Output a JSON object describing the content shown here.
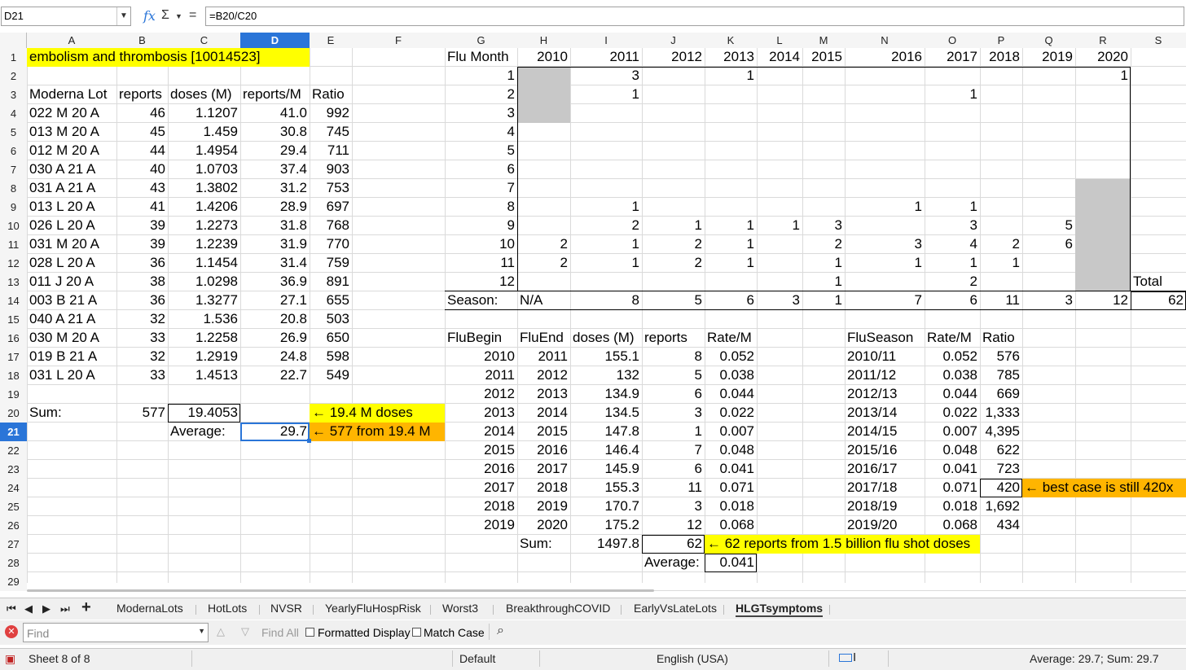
{
  "formula_bar": {
    "name_box": "D21",
    "formula": "=B20/C20",
    "icons": [
      "function-wizard-icon",
      "sum-icon",
      "equals-icon"
    ]
  },
  "columns": [
    "A",
    "B",
    "C",
    "D",
    "E",
    "F",
    "G",
    "H",
    "I",
    "J",
    "K",
    "L",
    "M",
    "N",
    "O",
    "P",
    "Q",
    "R",
    "S"
  ],
  "active_col": "D",
  "active_row": 21,
  "rows": [
    1,
    2,
    3,
    4,
    5,
    6,
    7,
    8,
    9,
    10,
    11,
    12,
    13,
    14,
    15,
    16,
    17,
    18,
    19,
    20,
    21,
    22,
    23,
    24,
    25,
    26,
    27,
    28,
    29
  ],
  "colors": {
    "yellow": "#ffff00",
    "orange": "#ffb500",
    "gray": "#c8c8c8",
    "accent": "#2a75d8"
  },
  "cells": [
    [
      "A1",
      "embolism and thrombosis [10014523]",
      "l"
    ],
    [
      "A3",
      "Moderna Lot",
      "l"
    ],
    [
      "B3",
      "reports",
      "l"
    ],
    [
      "C3",
      "doses (M)",
      "l"
    ],
    [
      "D3",
      "reports/M",
      "l"
    ],
    [
      "E3",
      "Ratio",
      "l"
    ],
    [
      "A4",
      "022 M 20 A",
      "l"
    ],
    [
      "B4",
      "46",
      "r"
    ],
    [
      "C4",
      "1.1207",
      "r"
    ],
    [
      "D4",
      "41.0",
      "r"
    ],
    [
      "E4",
      "992",
      "r"
    ],
    [
      "A5",
      "013 M 20 A",
      "l"
    ],
    [
      "B5",
      "45",
      "r"
    ],
    [
      "C5",
      "1.459",
      "r"
    ],
    [
      "D5",
      "30.8",
      "r"
    ],
    [
      "E5",
      "745",
      "r"
    ],
    [
      "A6",
      "012 M 20 A",
      "l"
    ],
    [
      "B6",
      "44",
      "r"
    ],
    [
      "C6",
      "1.4954",
      "r"
    ],
    [
      "D6",
      "29.4",
      "r"
    ],
    [
      "E6",
      "711",
      "r"
    ],
    [
      "A7",
      "030 A 21 A",
      "l"
    ],
    [
      "B7",
      "40",
      "r"
    ],
    [
      "C7",
      "1.0703",
      "r"
    ],
    [
      "D7",
      "37.4",
      "r"
    ],
    [
      "E7",
      "903",
      "r"
    ],
    [
      "A8",
      "031 A 21 A",
      "l"
    ],
    [
      "B8",
      "43",
      "r"
    ],
    [
      "C8",
      "1.3802",
      "r"
    ],
    [
      "D8",
      "31.2",
      "r"
    ],
    [
      "E8",
      "753",
      "r"
    ],
    [
      "A9",
      "013 L 20 A",
      "l"
    ],
    [
      "B9",
      "41",
      "r"
    ],
    [
      "C9",
      "1.4206",
      "r"
    ],
    [
      "D9",
      "28.9",
      "r"
    ],
    [
      "E9",
      "697",
      "r"
    ],
    [
      "A10",
      "026 L 20 A",
      "l"
    ],
    [
      "B10",
      "39",
      "r"
    ],
    [
      "C10",
      "1.2273",
      "r"
    ],
    [
      "D10",
      "31.8",
      "r"
    ],
    [
      "E10",
      "768",
      "r"
    ],
    [
      "A11",
      "031 M 20 A",
      "l"
    ],
    [
      "B11",
      "39",
      "r"
    ],
    [
      "C11",
      "1.2239",
      "r"
    ],
    [
      "D11",
      "31.9",
      "r"
    ],
    [
      "E11",
      "770",
      "r"
    ],
    [
      "A12",
      "028 L 20 A",
      "l"
    ],
    [
      "B12",
      "36",
      "r"
    ],
    [
      "C12",
      "1.1454",
      "r"
    ],
    [
      "D12",
      "31.4",
      "r"
    ],
    [
      "E12",
      "759",
      "r"
    ],
    [
      "A13",
      "011 J 20 A",
      "l"
    ],
    [
      "B13",
      "38",
      "r"
    ],
    [
      "C13",
      "1.0298",
      "r"
    ],
    [
      "D13",
      "36.9",
      "r"
    ],
    [
      "E13",
      "891",
      "r"
    ],
    [
      "A14",
      "003 B 21 A",
      "l"
    ],
    [
      "B14",
      "36",
      "r"
    ],
    [
      "C14",
      "1.3277",
      "r"
    ],
    [
      "D14",
      "27.1",
      "r"
    ],
    [
      "E14",
      "655",
      "r"
    ],
    [
      "A15",
      "040 A 21 A",
      "l"
    ],
    [
      "B15",
      "32",
      "r"
    ],
    [
      "C15",
      "1.536",
      "r"
    ],
    [
      "D15",
      "20.8",
      "r"
    ],
    [
      "E15",
      "503",
      "r"
    ],
    [
      "A16",
      "030 M 20 A",
      "l"
    ],
    [
      "B16",
      "33",
      "r"
    ],
    [
      "C16",
      "1.2258",
      "r"
    ],
    [
      "D16",
      "26.9",
      "r"
    ],
    [
      "E16",
      "650",
      "r"
    ],
    [
      "A17",
      "019 B 21 A",
      "l"
    ],
    [
      "B17",
      "32",
      "r"
    ],
    [
      "C17",
      "1.2919",
      "r"
    ],
    [
      "D17",
      "24.8",
      "r"
    ],
    [
      "E17",
      "598",
      "r"
    ],
    [
      "A18",
      "031 L 20 A",
      "l"
    ],
    [
      "B18",
      "33",
      "r"
    ],
    [
      "C18",
      "1.4513",
      "r"
    ],
    [
      "D18",
      "22.7",
      "r"
    ],
    [
      "E18",
      "549",
      "r"
    ],
    [
      "A20",
      "Sum:",
      "l"
    ],
    [
      "B20",
      "577",
      "r"
    ],
    [
      "C20",
      "19.4053",
      "r"
    ],
    [
      "E20",
      "← 19.4 M doses",
      "l"
    ],
    [
      "C21",
      "Average:",
      "l"
    ],
    [
      "D21",
      "29.7",
      "r"
    ],
    [
      "E21",
      "← 577 from 19.4 M",
      "l"
    ],
    [
      "G1",
      "Flu Month",
      "l"
    ],
    [
      "H1",
      "2010",
      "r"
    ],
    [
      "I1",
      "2011",
      "r"
    ],
    [
      "J1",
      "2012",
      "r"
    ],
    [
      "K1",
      "2013",
      "r"
    ],
    [
      "L1",
      "2014",
      "r"
    ],
    [
      "M1",
      "2015",
      "r"
    ],
    [
      "N1",
      "2016",
      "r"
    ],
    [
      "O1",
      "2017",
      "r"
    ],
    [
      "P1",
      "2018",
      "r"
    ],
    [
      "Q1",
      "2019",
      "r"
    ],
    [
      "R1",
      "2020",
      "r"
    ],
    [
      "G2",
      "1",
      "r"
    ],
    [
      "I2",
      "3",
      "r"
    ],
    [
      "K2",
      "1",
      "r"
    ],
    [
      "R2",
      "1",
      "r"
    ],
    [
      "G3",
      "2",
      "r"
    ],
    [
      "I3",
      "1",
      "r"
    ],
    [
      "O3",
      "1",
      "r"
    ],
    [
      "G4",
      "3",
      "r"
    ],
    [
      "G5",
      "4",
      "r"
    ],
    [
      "G6",
      "5",
      "r"
    ],
    [
      "G7",
      "6",
      "r"
    ],
    [
      "G8",
      "7",
      "r"
    ],
    [
      "G9",
      "8",
      "r"
    ],
    [
      "I9",
      "1",
      "r"
    ],
    [
      "N9",
      "1",
      "r"
    ],
    [
      "O9",
      "1",
      "r"
    ],
    [
      "G10",
      "9",
      "r"
    ],
    [
      "I10",
      "2",
      "r"
    ],
    [
      "J10",
      "1",
      "r"
    ],
    [
      "K10",
      "1",
      "r"
    ],
    [
      "L10",
      "1",
      "r"
    ],
    [
      "M10",
      "3",
      "r"
    ],
    [
      "O10",
      "3",
      "r"
    ],
    [
      "Q10",
      "5",
      "r"
    ],
    [
      "G11",
      "10",
      "r"
    ],
    [
      "H11",
      "2",
      "r"
    ],
    [
      "I11",
      "1",
      "r"
    ],
    [
      "J11",
      "2",
      "r"
    ],
    [
      "K11",
      "1",
      "r"
    ],
    [
      "M11",
      "2",
      "r"
    ],
    [
      "N11",
      "3",
      "r"
    ],
    [
      "O11",
      "4",
      "r"
    ],
    [
      "P11",
      "2",
      "r"
    ],
    [
      "Q11",
      "6",
      "r"
    ],
    [
      "G12",
      "11",
      "r"
    ],
    [
      "H12",
      "2",
      "r"
    ],
    [
      "I12",
      "1",
      "r"
    ],
    [
      "J12",
      "2",
      "r"
    ],
    [
      "K12",
      "1",
      "r"
    ],
    [
      "M12",
      "1",
      "r"
    ],
    [
      "N12",
      "1",
      "r"
    ],
    [
      "O12",
      "1",
      "r"
    ],
    [
      "P12",
      "1",
      "r"
    ],
    [
      "G13",
      "12",
      "r"
    ],
    [
      "M13",
      "1",
      "r"
    ],
    [
      "O13",
      "2",
      "r"
    ],
    [
      "S13",
      "Total",
      "l"
    ],
    [
      "G14",
      "Season:",
      "l"
    ],
    [
      "H14",
      "N/A",
      "l"
    ],
    [
      "I14",
      "8",
      "r"
    ],
    [
      "J14",
      "5",
      "r"
    ],
    [
      "K14",
      "6",
      "r"
    ],
    [
      "L14",
      "3",
      "r"
    ],
    [
      "M14",
      "1",
      "r"
    ],
    [
      "N14",
      "7",
      "r"
    ],
    [
      "O14",
      "6",
      "r"
    ],
    [
      "P14",
      "11",
      "r"
    ],
    [
      "Q14",
      "3",
      "r"
    ],
    [
      "R14",
      "12",
      "r"
    ],
    [
      "S14",
      "62",
      "r"
    ],
    [
      "G16",
      "FluBegin",
      "l"
    ],
    [
      "H16",
      "FluEnd",
      "l"
    ],
    [
      "I16",
      "doses (M)",
      "l"
    ],
    [
      "J16",
      "reports",
      "l"
    ],
    [
      "K16",
      "Rate/M",
      "l"
    ],
    [
      "N16",
      "FluSeason",
      "l"
    ],
    [
      "O16",
      "Rate/M",
      "l"
    ],
    [
      "P16",
      "Ratio",
      "l"
    ],
    [
      "G17",
      "2010",
      "r"
    ],
    [
      "H17",
      "2011",
      "r"
    ],
    [
      "I17",
      "155.1",
      "r"
    ],
    [
      "J17",
      "8",
      "r"
    ],
    [
      "K17",
      "0.052",
      "r"
    ],
    [
      "N17",
      "2010/11",
      "l"
    ],
    [
      "O17",
      "0.052",
      "r"
    ],
    [
      "P17",
      "576",
      "r"
    ],
    [
      "G18",
      "2011",
      "r"
    ],
    [
      "H18",
      "2012",
      "r"
    ],
    [
      "I18",
      "132",
      "r"
    ],
    [
      "J18",
      "5",
      "r"
    ],
    [
      "K18",
      "0.038",
      "r"
    ],
    [
      "N18",
      "2011/12",
      "l"
    ],
    [
      "O18",
      "0.038",
      "r"
    ],
    [
      "P18",
      "785",
      "r"
    ],
    [
      "G19",
      "2012",
      "r"
    ],
    [
      "H19",
      "2013",
      "r"
    ],
    [
      "I19",
      "134.9",
      "r"
    ],
    [
      "J19",
      "6",
      "r"
    ],
    [
      "K19",
      "0.044",
      "r"
    ],
    [
      "N19",
      "2012/13",
      "l"
    ],
    [
      "O19",
      "0.044",
      "r"
    ],
    [
      "P19",
      "669",
      "r"
    ],
    [
      "G20",
      "2013",
      "r"
    ],
    [
      "H20",
      "2014",
      "r"
    ],
    [
      "I20",
      "134.5",
      "r"
    ],
    [
      "J20",
      "3",
      "r"
    ],
    [
      "K20",
      "0.022",
      "r"
    ],
    [
      "N20",
      "2013/14",
      "l"
    ],
    [
      "O20",
      "0.022",
      "r"
    ],
    [
      "P20",
      "1,333",
      "r"
    ],
    [
      "G21",
      "2014",
      "r"
    ],
    [
      "H21",
      "2015",
      "r"
    ],
    [
      "I21",
      "147.8",
      "r"
    ],
    [
      "J21",
      "1",
      "r"
    ],
    [
      "K21",
      "0.007",
      "r"
    ],
    [
      "N21",
      "2014/15",
      "l"
    ],
    [
      "O21",
      "0.007",
      "r"
    ],
    [
      "P21",
      "4,395",
      "r"
    ],
    [
      "G22",
      "2015",
      "r"
    ],
    [
      "H22",
      "2016",
      "r"
    ],
    [
      "I22",
      "146.4",
      "r"
    ],
    [
      "J22",
      "7",
      "r"
    ],
    [
      "K22",
      "0.048",
      "r"
    ],
    [
      "N22",
      "2015/16",
      "l"
    ],
    [
      "O22",
      "0.048",
      "r"
    ],
    [
      "P22",
      "622",
      "r"
    ],
    [
      "G23",
      "2016",
      "r"
    ],
    [
      "H23",
      "2017",
      "r"
    ],
    [
      "I23",
      "145.9",
      "r"
    ],
    [
      "J23",
      "6",
      "r"
    ],
    [
      "K23",
      "0.041",
      "r"
    ],
    [
      "N23",
      "2016/17",
      "l"
    ],
    [
      "O23",
      "0.041",
      "r"
    ],
    [
      "P23",
      "723",
      "r"
    ],
    [
      "G24",
      "2017",
      "r"
    ],
    [
      "H24",
      "2018",
      "r"
    ],
    [
      "I24",
      "155.3",
      "r"
    ],
    [
      "J24",
      "11",
      "r"
    ],
    [
      "K24",
      "0.071",
      "r"
    ],
    [
      "N24",
      "2017/18",
      "l"
    ],
    [
      "O24",
      "0.071",
      "r"
    ],
    [
      "P24",
      "420",
      "r"
    ],
    [
      "Q24",
      "← best case is still 420x",
      "l"
    ],
    [
      "G25",
      "2018",
      "r"
    ],
    [
      "H25",
      "2019",
      "r"
    ],
    [
      "I25",
      "170.7",
      "r"
    ],
    [
      "J25",
      "3",
      "r"
    ],
    [
      "K25",
      "0.018",
      "r"
    ],
    [
      "N25",
      "2018/19",
      "l"
    ],
    [
      "O25",
      "0.018",
      "r"
    ],
    [
      "P25",
      "1,692",
      "r"
    ],
    [
      "G26",
      "2019",
      "r"
    ],
    [
      "H26",
      "2020",
      "r"
    ],
    [
      "I26",
      "175.2",
      "r"
    ],
    [
      "J26",
      "12",
      "r"
    ],
    [
      "K26",
      "0.068",
      "r"
    ],
    [
      "N26",
      "2019/20",
      "l"
    ],
    [
      "O26",
      "0.068",
      "r"
    ],
    [
      "P26",
      "434",
      "r"
    ],
    [
      "H27",
      "Sum:",
      "l"
    ],
    [
      "I27",
      "1497.8",
      "r"
    ],
    [
      "J27",
      "62",
      "r"
    ],
    [
      "K27",
      "← 62 reports from 1.5 billion flu shot doses",
      "l"
    ],
    [
      "J28",
      "Average:",
      "l"
    ],
    [
      "K28",
      "0.041",
      "r"
    ]
  ],
  "sheet_tabs": [
    "ModernaLots",
    "HotLots",
    "NVSR",
    "YearlyFluHospRisk",
    "Worst3",
    "BreakthroughCOVID",
    "EarlyVsLateLots",
    "HLGTsymptoms"
  ],
  "active_tab": "HLGTsymptoms",
  "find_bar": {
    "placeholder": "Find",
    "find_all": "Find All",
    "formatted_display": "Formatted Display",
    "match_case": "Match Case"
  },
  "status": {
    "sheet": "Sheet 8 of 8",
    "style": "Default",
    "language": "English (USA)",
    "summary": "Average: 29.7; Sum: 29.7"
  }
}
